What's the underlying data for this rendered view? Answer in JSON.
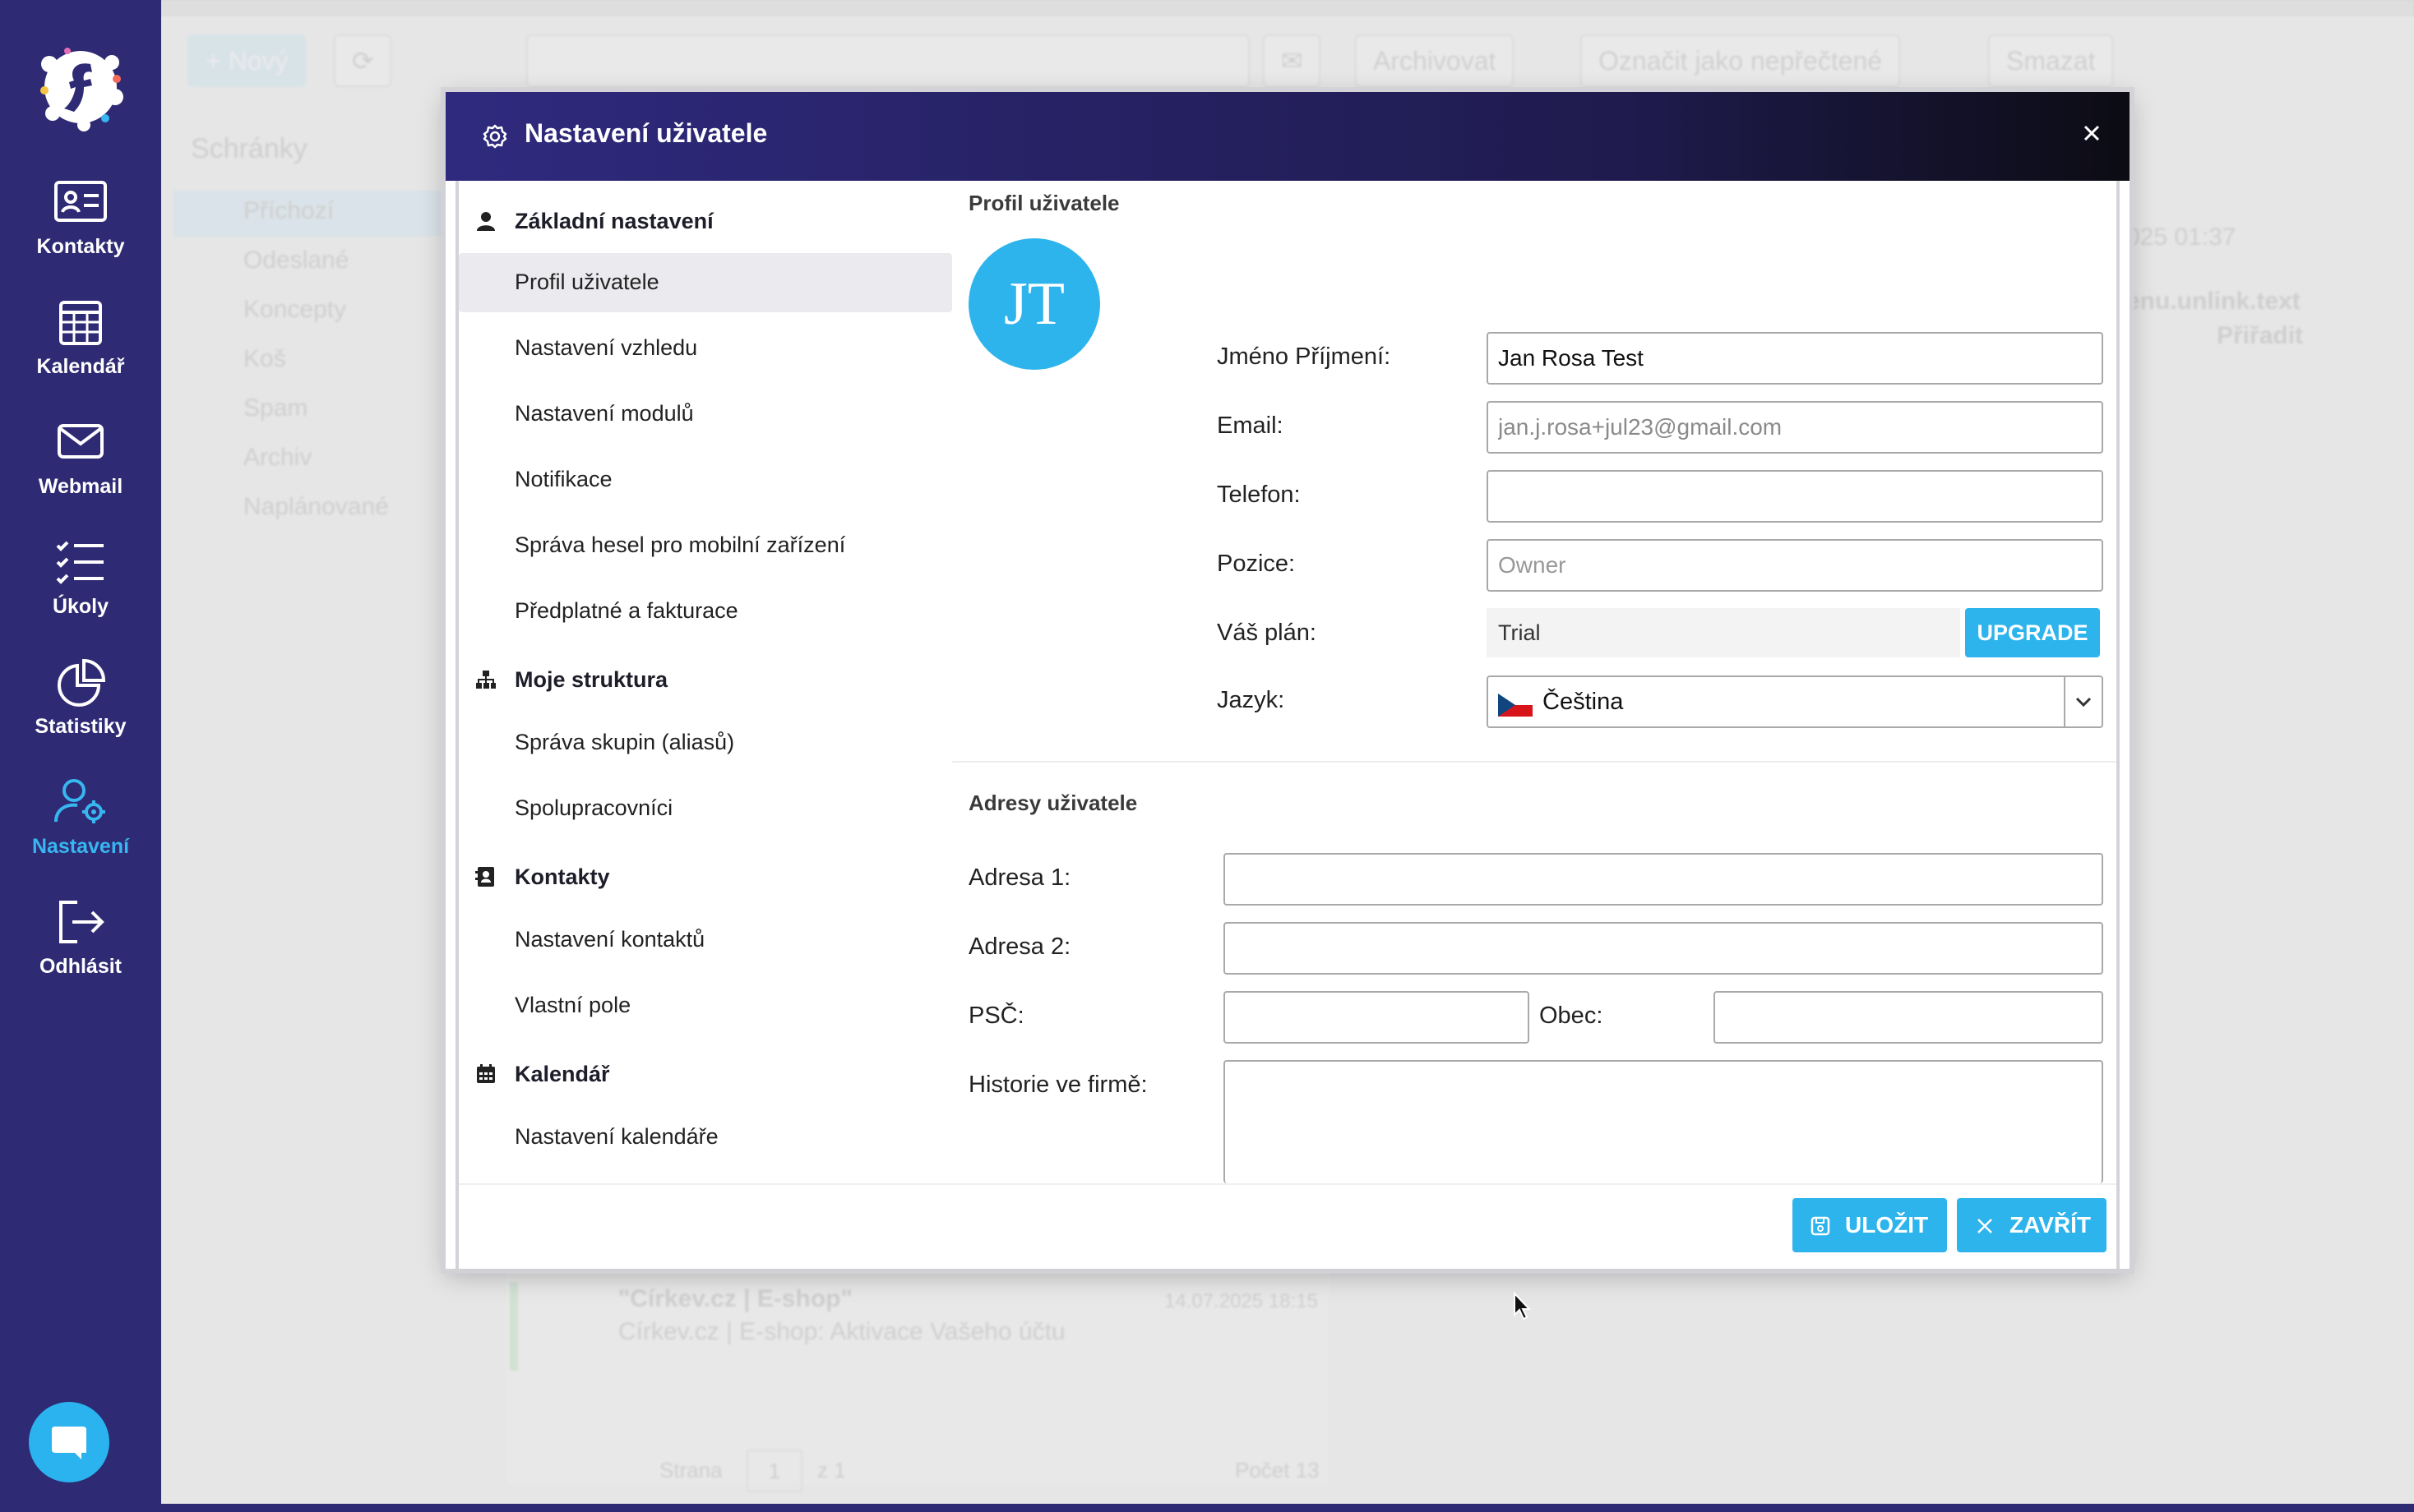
{
  "sidebar": {
    "items": [
      {
        "label": "Kontakty",
        "icon": "contact-card-icon"
      },
      {
        "label": "Kalendář",
        "icon": "calendar-icon"
      },
      {
        "label": "Webmail",
        "icon": "mail-icon"
      },
      {
        "label": "Úkoly",
        "icon": "tasks-icon"
      },
      {
        "label": "Statistiky",
        "icon": "pie-chart-icon"
      },
      {
        "label": "Nastavení",
        "icon": "user-settings-icon",
        "active": true
      },
      {
        "label": "Odhlásit",
        "icon": "logout-icon"
      }
    ],
    "active_color": "#38b6f0",
    "bg_color": "#2e2a74"
  },
  "background": {
    "new_button": "+ Nový",
    "archive_button": "Archivovat",
    "mark_unread_button": "Označit jako nepřečtené",
    "delete_button": "Smazat",
    "mailboxes_title": "Schránky",
    "folders": [
      "Příchozí",
      "Odeslané",
      "Koncepty",
      "Koš",
      "Spam",
      "Archiv",
      "Naplánované"
    ],
    "date_fragment": "025 01:37",
    "unlink_text": "enu.unlink.text",
    "assign_text": "Přiřadit",
    "email_sender": "\"Církev.cz | E-shop\"",
    "email_date": "14.07.2025 18:15",
    "email_subject": "Církev.cz | E-shop: Aktivace Vašeho účtu",
    "pager_label": "Strana",
    "pager_page": "1",
    "pager_of": "z 1",
    "count_label": "Počet 13"
  },
  "modal": {
    "title": "Nastavení uživatele",
    "menu": {
      "sections": [
        {
          "title": "Základní nastavení",
          "icon": "user-icon",
          "items": [
            "Profil uživatele",
            "Nastavení vzhledu",
            "Nastavení modulů",
            "Notifikace",
            "Správa hesel pro mobilní zařízení",
            "Předplatné a fakturace"
          ]
        },
        {
          "title": "Moje struktura",
          "icon": "org-structure-icon",
          "items": [
            "Správa skupin (aliasů)",
            "Spolupracovníci"
          ]
        },
        {
          "title": "Kontakty",
          "icon": "address-book-icon",
          "items": [
            "Nastavení kontaktů",
            "Vlastní pole"
          ]
        },
        {
          "title": "Kalendář",
          "icon": "calendar-icon",
          "items": [
            "Nastavení kalendáře"
          ]
        }
      ],
      "selected": "Profil uživatele"
    },
    "profile": {
      "section_title": "Profil uživatele",
      "avatar_initials": "JT",
      "name_label": "Jméno Příjmení:",
      "name_value": "Jan Rosa Test",
      "email_label": "Email:",
      "email_value": "jan.j.rosa+jul23@gmail.com",
      "phone_label": "Telefon:",
      "phone_value": "",
      "position_label": "Pozice:",
      "position_placeholder": "Owner",
      "plan_label": "Váš plán:",
      "plan_value": "Trial",
      "upgrade_button": "UPGRADE",
      "language_label": "Jazyk:",
      "language_value": "Čeština"
    },
    "address": {
      "section_title": "Adresy uživatele",
      "address1_label": "Adresa 1:",
      "address2_label": "Adresa 2:",
      "zip_label": "PSČ:",
      "city_label": "Obec:",
      "history_label": "Historie ve firmě:"
    },
    "footer": {
      "save_button": "ULOŽIT",
      "close_button": "ZAVŘÍT"
    },
    "accent_color": "#2eb4ec"
  }
}
